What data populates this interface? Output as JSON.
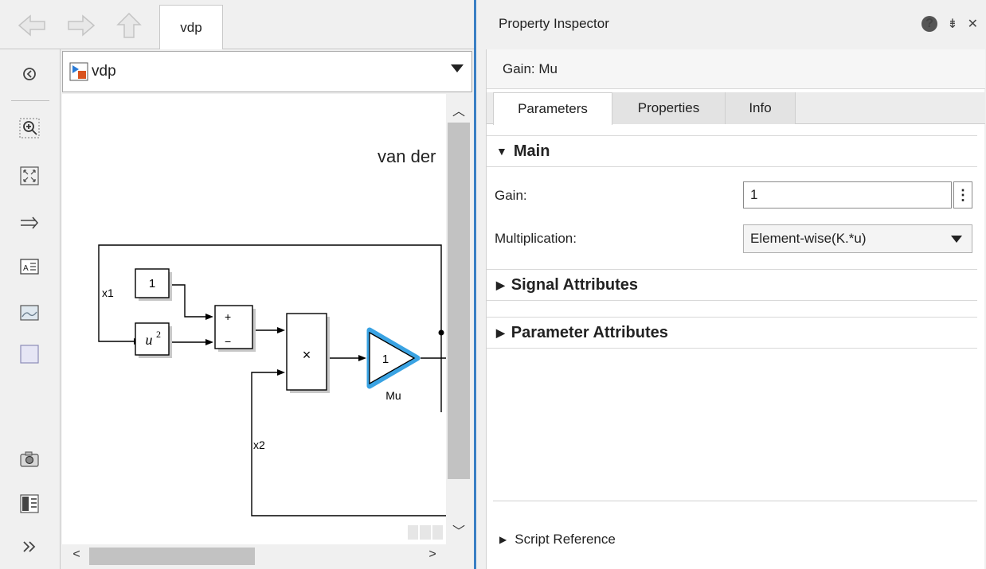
{
  "editor": {
    "tab_label": "vdp",
    "address": "vdp",
    "diagram_title": "van der",
    "blocks": {
      "constant": "1",
      "square": "u",
      "square_exp": "2",
      "sum_plus": "+",
      "sum_minus": "−",
      "product": "×",
      "gain_value": "1",
      "gain_name": "Mu"
    },
    "signals": {
      "x1": "x1",
      "x2": "x2"
    },
    "colors": {
      "selection": "#3aa3e3"
    }
  },
  "inspector": {
    "title": "Property Inspector",
    "block_name": "Gain: Mu",
    "tabs": [
      {
        "label": "Parameters",
        "active": true
      },
      {
        "label": "Properties",
        "active": false
      },
      {
        "label": "Info",
        "active": false
      }
    ],
    "sections": {
      "main": "Main",
      "signal": "Signal Attributes",
      "param": "Parameter Attributes"
    },
    "fields": {
      "gain_label": "Gain:",
      "gain_value": "1",
      "mult_label": "Multiplication:",
      "mult_value": "Element-wise(K.*u)"
    },
    "script_reference": "Script Reference"
  }
}
